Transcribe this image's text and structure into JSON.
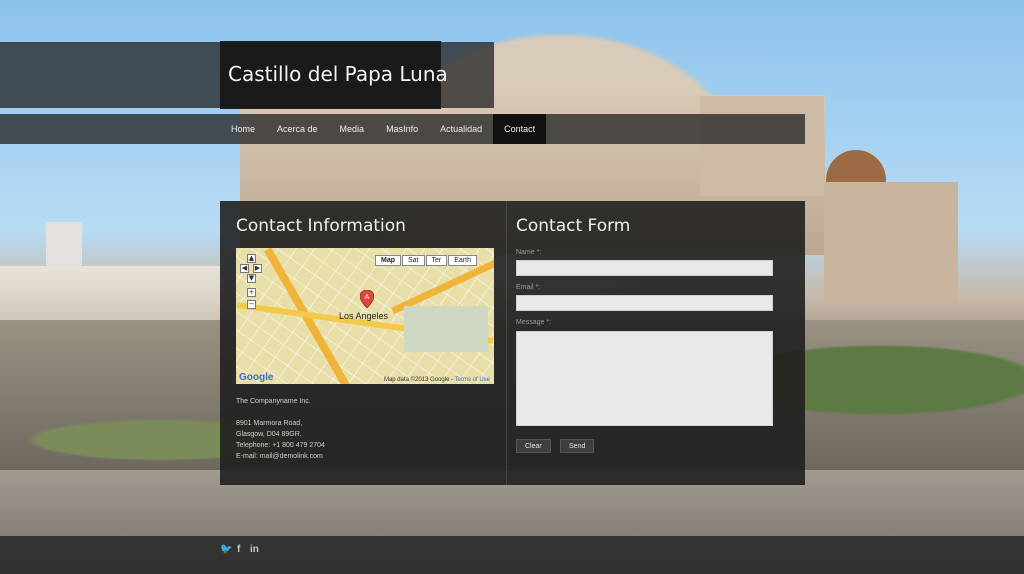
{
  "site": {
    "title": "Castillo del Papa Luna"
  },
  "nav": {
    "items": [
      {
        "label": "Home",
        "active": false
      },
      {
        "label": "Acerca de",
        "active": false
      },
      {
        "label": "Media",
        "active": false
      },
      {
        "label": "MasInfo",
        "active": false
      },
      {
        "label": "Actualidad",
        "active": false
      },
      {
        "label": "Contact",
        "active": true
      }
    ]
  },
  "contact_info": {
    "heading": "Contact Information",
    "map": {
      "types": [
        "Map",
        "Sat",
        "Ter",
        "Earth"
      ],
      "selected_type": "Map",
      "city_label": "Los Angeles",
      "marker_letter": "A",
      "attribution": "Map data ©2013 Google -",
      "terms_link": "Terms of Use",
      "logo": "Google"
    },
    "company": "The Companyname Inc.",
    "address_line1": "8901 Marmora Road,",
    "address_line2": "Glasgow, D04 89GR.",
    "telephone": "Telephone: +1 800 479 2704",
    "email": "E-mail: mail@demolink.com"
  },
  "contact_form": {
    "heading": "Contact Form",
    "name_label": "Name *:",
    "email_label": "Email *:",
    "message_label": "Message *:",
    "name_value": "",
    "email_value": "",
    "message_value": "",
    "clear_label": "Clear",
    "send_label": "Send"
  },
  "footer": {
    "social": [
      {
        "icon": "twitter-icon",
        "glyph": "🐦"
      },
      {
        "icon": "facebook-icon",
        "glyph": "f"
      },
      {
        "icon": "linkedin-icon",
        "glyph": "in"
      }
    ]
  },
  "colors": {
    "panel_bg": "#1c1c1c",
    "nav_active_bg": "#111111",
    "field_bg": "#e9e9e9"
  }
}
